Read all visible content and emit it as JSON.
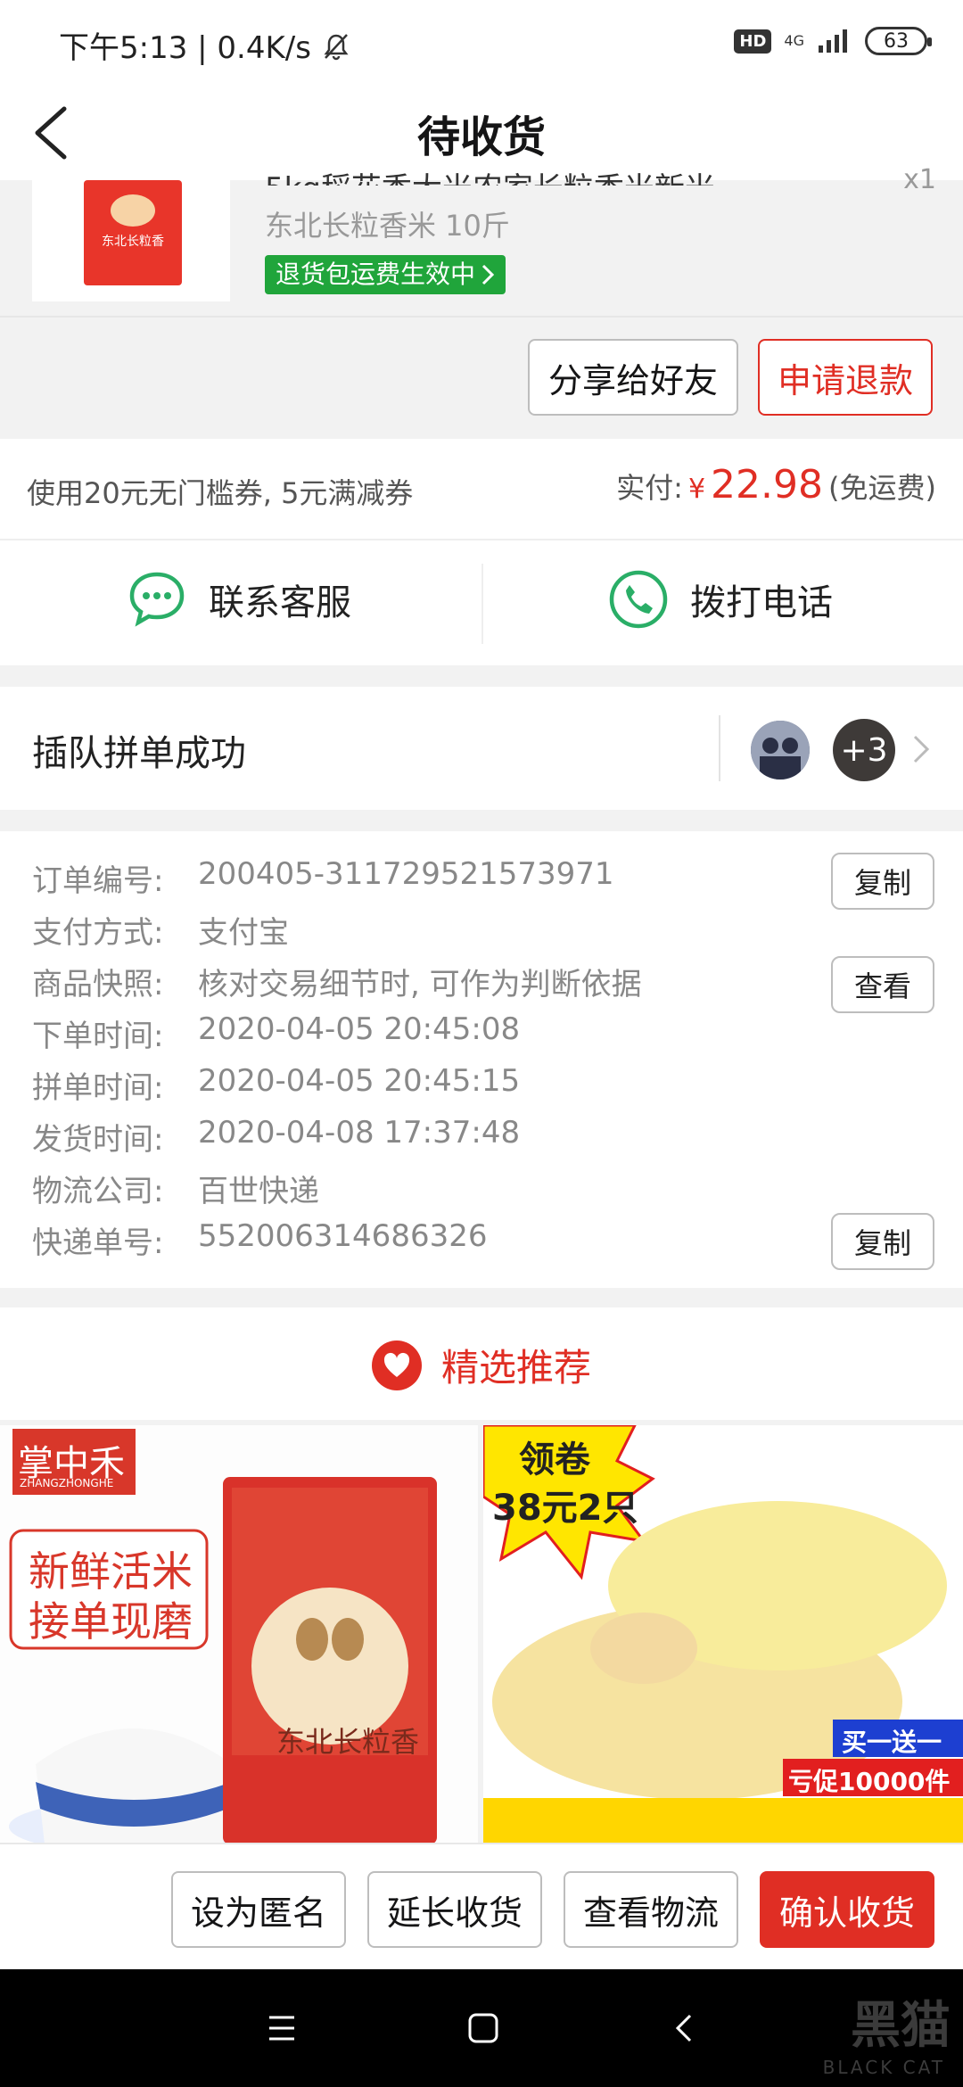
{
  "status_bar": {
    "left_text": "下午5:13 | 0.4K/s",
    "hd": "HD",
    "network": "4G",
    "battery": "63"
  },
  "header": {
    "title": "待收货"
  },
  "product": {
    "title_partial": "5kg稻花香大米农家长粒香米新米",
    "quantity_partial": "x1",
    "spec": "东北长粒香米 10斤",
    "return_badge": "退货包运费生效中",
    "thumb_label": "东北长粒香"
  },
  "order_actions": {
    "share": "分享给好友",
    "refund": "申请退款"
  },
  "payment": {
    "coupon_text": "使用20元无门槛券, 5元满减券",
    "paid_label": "实付:",
    "currency": "¥",
    "amount": "22.98",
    "shipping_note": "(免运费)"
  },
  "contact": {
    "service": "联系客服",
    "call": "拨打电话"
  },
  "group_buy": {
    "status": "插队拼单成功",
    "extra_count": "+3"
  },
  "order_info": {
    "rows": [
      {
        "key": "订单编号:",
        "value": "200405-311729521573971"
      },
      {
        "key": "支付方式:",
        "value": "支付宝"
      },
      {
        "key": "商品快照:",
        "value": "核对交易细节时, 可作为判断依据"
      },
      {
        "key": "下单时间:",
        "value": "2020-04-05 20:45:08"
      },
      {
        "key": "拼单时间:",
        "value": "2020-04-05 20:45:15"
      },
      {
        "key": "发货时间:",
        "value": "2020-04-08 17:37:48"
      },
      {
        "key": "物流公司:",
        "value": "百世快递"
      },
      {
        "key": "快递单号:",
        "value": "552006314686326"
      }
    ],
    "copy_label": "复制",
    "view_label": "查看"
  },
  "recommend": {
    "title": "精选推荐"
  },
  "rec_products": {
    "p1": {
      "brand": "掌中禾",
      "brand_en": "ZHANGZHONGHE",
      "slogan_1": "新鲜活米",
      "slogan_2": "接单现磨",
      "bag_text": "东北长粒香"
    },
    "p2": {
      "coupon_1": "领卷",
      "coupon_2": "38元2只",
      "promo_1": "买一送一",
      "promo_2": "亏促10000件"
    }
  },
  "bottom_bar": {
    "anonymous": "设为匿名",
    "extend": "延长收货",
    "logistics": "查看物流",
    "confirm": "确认收货"
  },
  "watermark": {
    "cn": "黑猫",
    "en": "BLACK CAT"
  },
  "colors": {
    "accent": "#e02e24",
    "green": "#20a53b",
    "wechat_green": "#2aae67"
  }
}
